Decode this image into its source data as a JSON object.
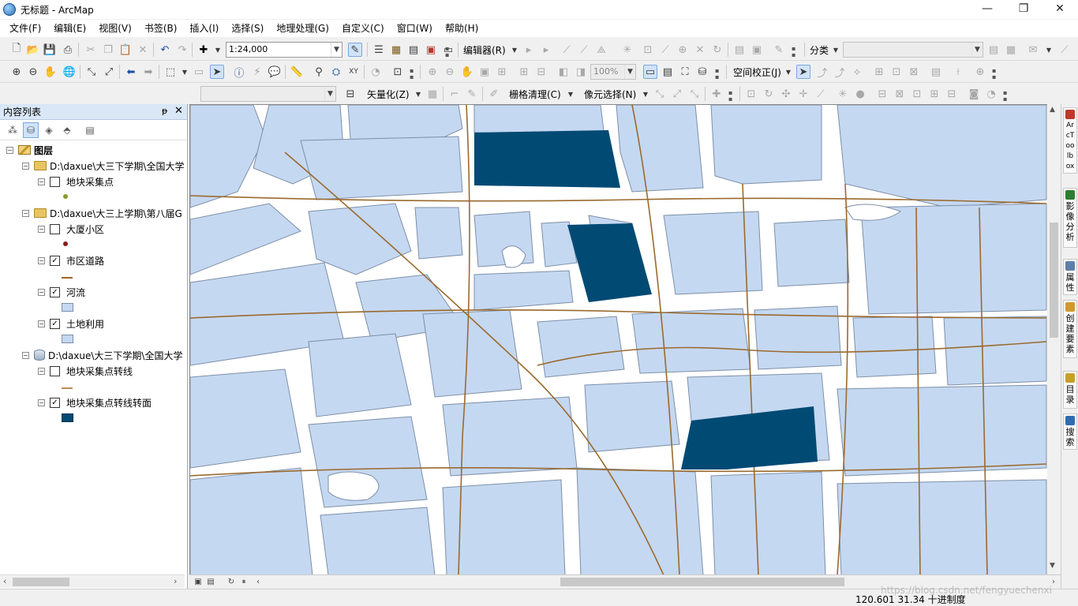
{
  "window": {
    "title": "无标题 - ArcMap",
    "icon": "arcmap-globe-icon",
    "controls": {
      "minimize": "—",
      "maximize": "❐",
      "close": "✕"
    }
  },
  "menus": [
    "文件(F)",
    "编辑(E)",
    "视图(V)",
    "书签(B)",
    "插入(I)",
    "选择(S)",
    "地理处理(G)",
    "自定义(C)",
    "窗口(W)",
    "帮助(H)"
  ],
  "toolbars": {
    "scale_value": "1:24,000",
    "editor_label": "编辑器(R)",
    "classify_label": "分类",
    "zoom_value": "100%",
    "spatial_adjust_label": "空间校正(J)",
    "vectorize_label": "矢量化(Z)",
    "raster_cleanup_label": "栅格清理(C)",
    "pixel_select_label": "像元选择(N)"
  },
  "toc": {
    "title": "内容列表",
    "pin": "ᵽ",
    "close": "✕",
    "root_label": "图层",
    "tree": [
      {
        "kind": "folder",
        "label": "D:\\daxue\\大三下学期\\全国大学"
      },
      {
        "kind": "layer",
        "label": "地块采集点",
        "checked": false,
        "symbol": "point",
        "color": "#8a9a2c"
      },
      {
        "kind": "folder",
        "label": "D:\\daxue\\大三上学期\\第八届G"
      },
      {
        "kind": "layer",
        "label": "大厦小区",
        "checked": false,
        "symbol": "point",
        "color": "#8b1a1a"
      },
      {
        "kind": "layer",
        "label": "市区道路",
        "checked": true,
        "symbol": "line",
        "color": "#a0642a"
      },
      {
        "kind": "layer",
        "label": "河流",
        "checked": true,
        "symbol": "fill",
        "color": "#c5d8f1"
      },
      {
        "kind": "layer",
        "label": "土地利用",
        "checked": true,
        "symbol": "fill",
        "color": "#c5d8f1"
      },
      {
        "kind": "db",
        "label": "D:\\daxue\\大三下学期\\全国大学"
      },
      {
        "kind": "layer",
        "label": "地块采集点转线",
        "checked": false,
        "symbol": "line",
        "color": "#c08a50"
      },
      {
        "kind": "layer",
        "label": "地块采集点转线转面",
        "checked": true,
        "symbol": "fill",
        "color": "#004a74"
      }
    ]
  },
  "map": {
    "land_color": "#c5d8f1",
    "land_stroke": "#7d8fa8",
    "road_color": "#9a6a2e",
    "highlight_color": "#004a74"
  },
  "right_dock": [
    {
      "label": "ArcToolbox",
      "icon": "toolbox-icon"
    },
    {
      "label": "影像分析",
      "icon": "image-analysis-icon"
    },
    {
      "label": "属性",
      "icon": "attributes-icon"
    },
    {
      "label": "创建要素",
      "icon": "create-features-icon"
    },
    {
      "label": "目录",
      "icon": "catalog-icon"
    },
    {
      "label": "搜索",
      "icon": "search-icon"
    }
  ],
  "status": {
    "coords": "120.601  31.34 十进制度"
  },
  "watermark": "https://blog.csdn.net/fengyuechenxi"
}
